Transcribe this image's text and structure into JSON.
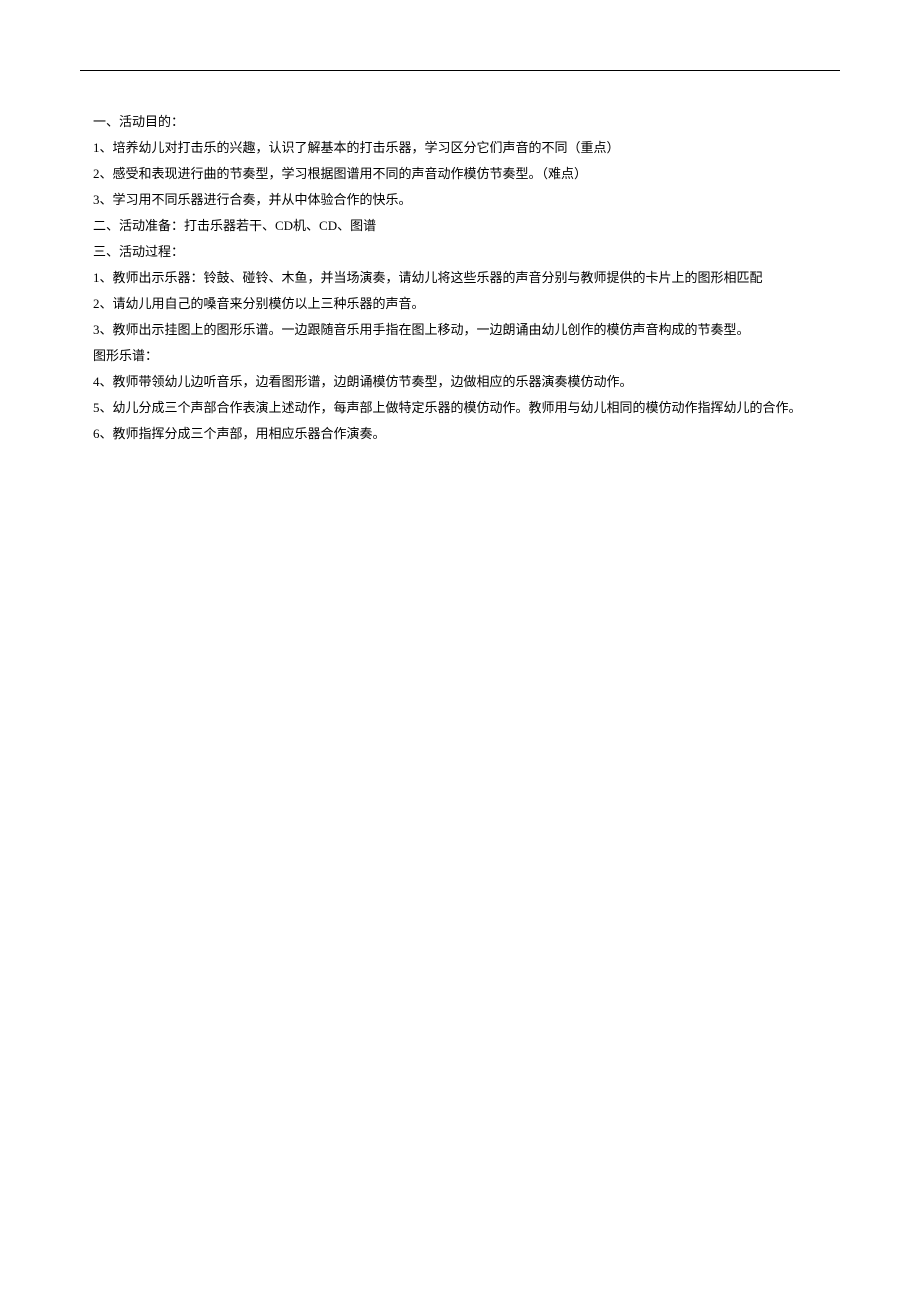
{
  "lines": [
    "一、活动目的：",
    "1、培养幼儿对打击乐的兴趣，认识了解基本的打击乐器，学习区分它们声音的不同（重点）",
    "2、感受和表现进行曲的节奏型，学习根据图谱用不同的声音动作模仿节奏型。（难点）",
    "3、学习用不同乐器进行合奏，并从中体验合作的快乐。",
    "二、活动准备：打击乐器若干、CD机、CD、图谱",
    "三、活动过程：",
    "1、教师出示乐器：铃鼓、碰铃、木鱼，并当场演奏，请幼儿将这些乐器的声音分别与教师提供的卡片上的图形相匹配",
    "2、请幼儿用自己的嗓音来分别模仿以上三种乐器的声音。",
    "3、教师出示挂图上的图形乐谱。一边跟随音乐用手指在图上移动，一边朗诵由幼儿创作的模仿声音构成的节奏型。",
    "图形乐谱：",
    "4、教师带领幼儿边听音乐，边看图形谱，边朗诵模仿节奏型，边做相应的乐器演奏模仿动作。",
    "5、幼儿分成三个声部合作表演上述动作，每声部上做特定乐器的模仿动作。教师用与幼儿相同的模仿动作指挥幼儿的合作。",
    "6、教师指挥分成三个声部，用相应乐器合作演奏。"
  ]
}
